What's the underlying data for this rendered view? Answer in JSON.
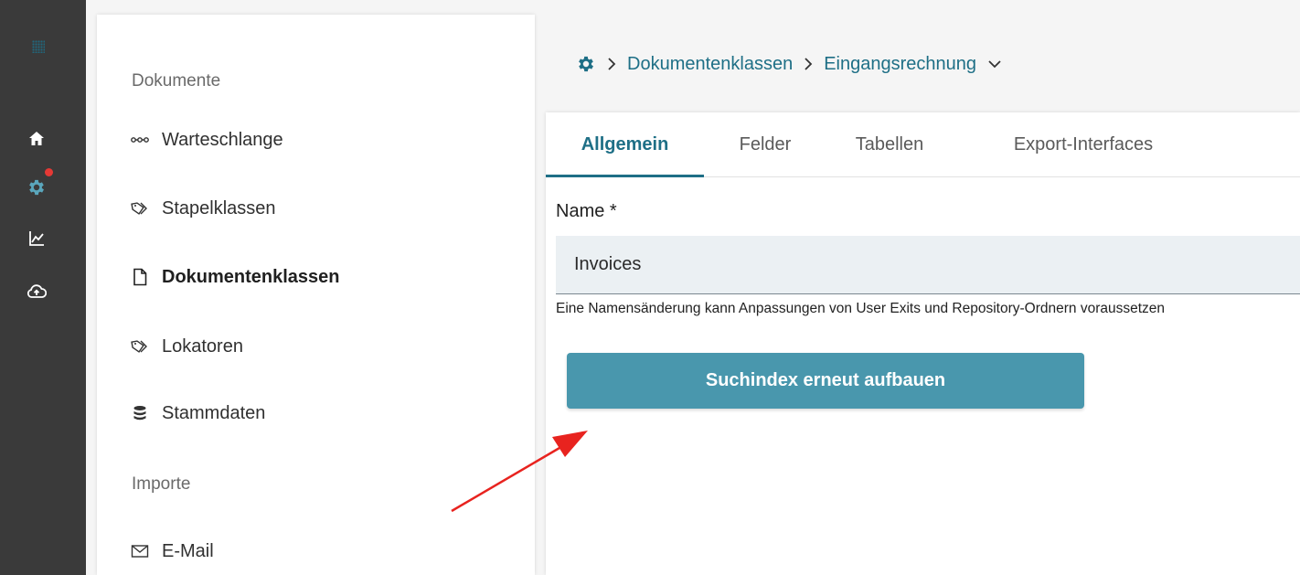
{
  "nav": {
    "section_documents": "Dokumente",
    "section_imports": "Importe",
    "items": [
      {
        "label": "Warteschlange",
        "icon": "queue-icon"
      },
      {
        "label": "Stapelklassen",
        "icon": "tag-icon"
      },
      {
        "label": "Dokumentenklassen",
        "icon": "document-icon",
        "active": true
      },
      {
        "label": "Lokatoren",
        "icon": "tag-icon"
      },
      {
        "label": "Stammdaten",
        "icon": "database-icon"
      },
      {
        "label": "E-Mail",
        "icon": "mail-icon"
      }
    ]
  },
  "rail": {
    "icons": [
      "logo-icon",
      "home-icon",
      "settings-icon",
      "chart-icon",
      "cloud-upload-icon"
    ],
    "notification_color": "#e53935"
  },
  "breadcrumb": {
    "item1": "Dokumentenklassen",
    "item2": "Eingangsrechnung"
  },
  "tabs": [
    {
      "label": "Allgemein",
      "active": true
    },
    {
      "label": "Felder"
    },
    {
      "label": "Tabellen"
    },
    {
      "label": "Export-Interfaces"
    }
  ],
  "form": {
    "name_label": "Name *",
    "name_value": "Invoices",
    "hint": "Eine Namensänderung kann Anpassungen von User Exits und Repository-Ordnern voraussetzen",
    "rebuild_button": "Suchindex erneut aufbauen"
  },
  "colors": {
    "accent": "#1e6f86",
    "button": "#4997ad",
    "rail": "#3a3a3a",
    "annotation_arrow": "#e8231f"
  }
}
